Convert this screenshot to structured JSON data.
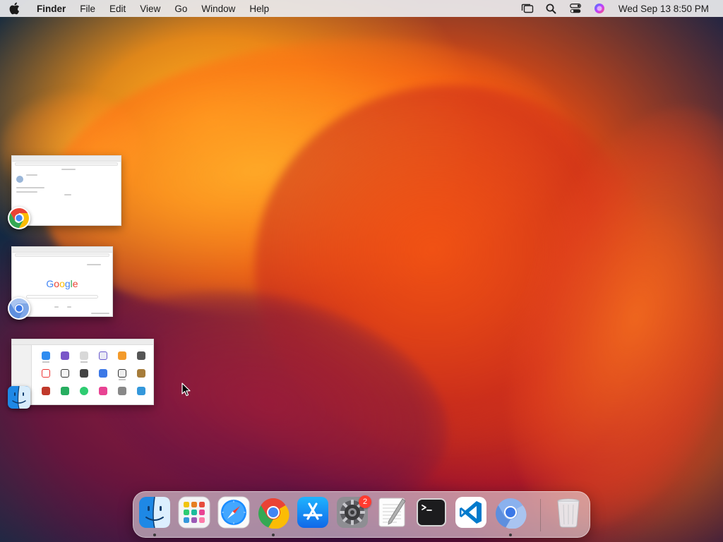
{
  "menubar": {
    "apple_icon": "apple-icon",
    "app_name": "Finder",
    "menus": [
      "File",
      "Edit",
      "View",
      "Go",
      "Window",
      "Help"
    ],
    "status_icons": [
      "stage-manager-icon",
      "search-icon",
      "control-center-icon",
      "siri-icon"
    ],
    "clock": "Wed Sep 13  8:50 PM"
  },
  "stage_manager": {
    "groups": [
      {
        "app": "Google Chrome",
        "icon": "chrome-icon",
        "content": "chrome-window-thumbnail"
      },
      {
        "app": "Chromium",
        "icon": "chromium-icon",
        "content": "google-homepage-thumbnail",
        "page_text": "Google"
      },
      {
        "app": "Finder",
        "icon": "finder-icon",
        "content": "applications-folder-thumbnail"
      }
    ]
  },
  "dock": {
    "items": [
      {
        "name": "Finder",
        "icon": "finder-icon",
        "running": true
      },
      {
        "name": "Launchpad",
        "icon": "launchpad-icon",
        "running": false
      },
      {
        "name": "Safari",
        "icon": "safari-icon",
        "running": false
      },
      {
        "name": "Google Chrome",
        "icon": "chrome-icon",
        "running": true
      },
      {
        "name": "App Store",
        "icon": "app-store-icon",
        "running": false
      },
      {
        "name": "System Settings",
        "icon": "system-settings-icon",
        "running": false,
        "badge": "2"
      },
      {
        "name": "TextEdit",
        "icon": "textedit-icon",
        "running": false
      },
      {
        "name": "Terminal",
        "icon": "terminal-icon",
        "running": false
      },
      {
        "name": "Visual Studio Code",
        "icon": "vscode-icon",
        "running": false
      },
      {
        "name": "Chromium",
        "icon": "chromium-icon",
        "running": true
      },
      {
        "name": "Trash",
        "icon": "trash-icon",
        "running": false
      }
    ]
  },
  "colors": {
    "menubar_bg": "#ececee",
    "badge_red": "#ff3b30",
    "finder_blue": "#1e88e5",
    "chrome_red": "#ea4335",
    "chrome_yellow": "#fbbc05",
    "chrome_green": "#34a853",
    "chrome_blue": "#4285f4"
  }
}
